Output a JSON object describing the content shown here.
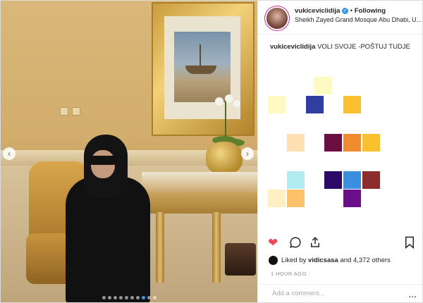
{
  "post": {
    "username": "vukiceviclidija",
    "verified_icon": "check",
    "separator": "•",
    "follow_status": "Following",
    "location": "Sheikh Zayed Grand Mosque Abu Dhabi, U...",
    "caption_user": "vukiceviclidija",
    "caption_text": "VOLI SVOJE -POŠTUJ TUDJE",
    "liked_by_prefix": "Liked by",
    "liked_by_user": "vidicsasa",
    "liked_by_suffix": "and 4,372 others",
    "timestamp": "1 HOUR AGO",
    "comment_placeholder": "Add a comment...",
    "more_icon": "..."
  },
  "carousel": {
    "prev_icon": "‹",
    "next_icon": "›",
    "slide_count": 10,
    "active_index": 7
  },
  "emoji_blocks": [
    {
      "color": "#fff9c4"
    },
    {
      "color": "#fff9c4"
    },
    {
      "color": "#303f9f"
    },
    {
      "color": "#fbc02d"
    },
    {
      "color": "#ffe0b2"
    },
    {
      "color": "#6a0f3f"
    },
    {
      "color": "#f28b30"
    },
    {
      "color": "#fbc02d"
    },
    {
      "color": "#b2ebf2"
    },
    {
      "color": "#2a0a66"
    },
    {
      "color": "#3a8fe0"
    },
    {
      "color": "#8b2d2d"
    },
    {
      "color": "#fff0c4"
    },
    {
      "color": "#fbc26a"
    },
    {
      "color": "#6a0f8a"
    }
  ],
  "colors": {
    "heart": "#ed4956",
    "verified": "#3897f0",
    "text": "#262626",
    "muted": "#8e8e8e"
  }
}
